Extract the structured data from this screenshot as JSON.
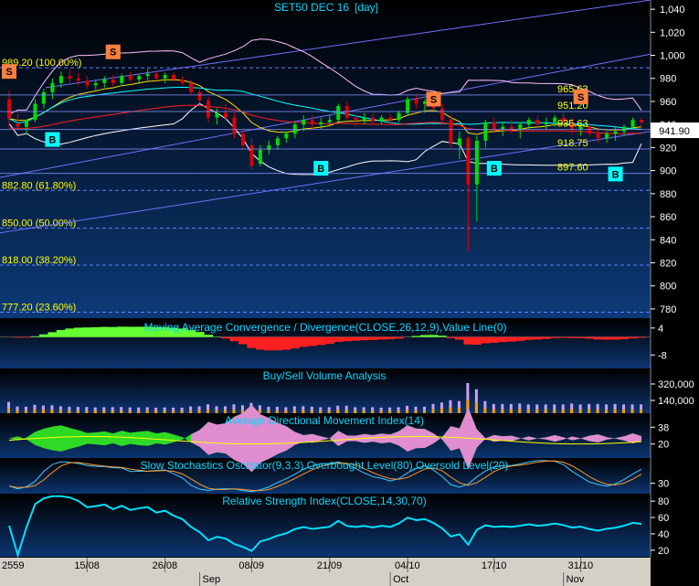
{
  "chart_data": {
    "type": "candlestick",
    "title": "SET50 DEC 16",
    "interval": "[day]",
    "colors": {
      "background_top": "#000000",
      "background_bottom": "#0b3a78",
      "up": "#00dd00",
      "down": "#dd0000",
      "signal_buy": "#00ffff",
      "signal_sell": "#ff8040",
      "axis_bg": "#000000",
      "date_bar": "#d4d0c8",
      "channel": "#7070ff",
      "fib": "#6080ff"
    },
    "price": {
      "ylim": [
        772,
        1048
      ],
      "yticks": [
        1040,
        1020,
        1000,
        980,
        960,
        940,
        920,
        900,
        880,
        860,
        840,
        820,
        800,
        780
      ],
      "ytick_labels": [
        "1,040",
        "1,020",
        "1,000",
        "980",
        "960",
        "940",
        "920",
        "900",
        "880",
        "860",
        "840",
        "820",
        "800",
        "780"
      ],
      "last": 941.9,
      "last_label": "941.90",
      "candles": [
        {
          "o": 962,
          "h": 970,
          "l": 938,
          "c": 945
        },
        {
          "o": 941,
          "h": 949,
          "l": 936,
          "c": 938
        },
        {
          "o": 938,
          "h": 944,
          "l": 932,
          "c": 944
        },
        {
          "o": 944,
          "h": 962,
          "l": 942,
          "c": 958
        },
        {
          "o": 958,
          "h": 971,
          "l": 954,
          "c": 968
        },
        {
          "o": 968,
          "h": 980,
          "l": 962,
          "c": 976
        },
        {
          "o": 976,
          "h": 986,
          "l": 972,
          "c": 982
        },
        {
          "o": 982,
          "h": 988,
          "l": 976,
          "c": 980
        },
        {
          "o": 980,
          "h": 985,
          "l": 974,
          "c": 978
        },
        {
          "o": 978,
          "h": 982,
          "l": 971,
          "c": 974
        },
        {
          "o": 974,
          "h": 979,
          "l": 970,
          "c": 976
        },
        {
          "o": 976,
          "h": 982,
          "l": 972,
          "c": 979
        },
        {
          "o": 979,
          "h": 983,
          "l": 973,
          "c": 976
        },
        {
          "o": 976,
          "h": 984,
          "l": 973,
          "c": 982
        },
        {
          "o": 982,
          "h": 986,
          "l": 977,
          "c": 979
        },
        {
          "o": 979,
          "h": 984,
          "l": 975,
          "c": 982
        },
        {
          "o": 982,
          "h": 988,
          "l": 978,
          "c": 984
        },
        {
          "o": 984,
          "h": 986,
          "l": 978,
          "c": 980
        },
        {
          "o": 980,
          "h": 985,
          "l": 976,
          "c": 983
        },
        {
          "o": 983,
          "h": 985,
          "l": 977,
          "c": 979
        },
        {
          "o": 979,
          "h": 982,
          "l": 974,
          "c": 976
        },
        {
          "o": 976,
          "h": 979,
          "l": 966,
          "c": 968
        },
        {
          "o": 968,
          "h": 972,
          "l": 958,
          "c": 961
        },
        {
          "o": 961,
          "h": 964,
          "l": 942,
          "c": 946
        },
        {
          "o": 946,
          "h": 954,
          "l": 940,
          "c": 950
        },
        {
          "o": 950,
          "h": 958,
          "l": 944,
          "c": 946
        },
        {
          "o": 946,
          "h": 950,
          "l": 928,
          "c": 932
        },
        {
          "o": 932,
          "h": 936,
          "l": 918,
          "c": 922
        },
        {
          "o": 922,
          "h": 928,
          "l": 900,
          "c": 904
        },
        {
          "o": 906,
          "h": 922,
          "l": 904,
          "c": 918
        },
        {
          "o": 918,
          "h": 926,
          "l": 914,
          "c": 922
        },
        {
          "o": 922,
          "h": 930,
          "l": 918,
          "c": 928
        },
        {
          "o": 928,
          "h": 934,
          "l": 924,
          "c": 932
        },
        {
          "o": 932,
          "h": 942,
          "l": 928,
          "c": 940
        },
        {
          "o": 940,
          "h": 948,
          "l": 934,
          "c": 944
        },
        {
          "o": 944,
          "h": 948,
          "l": 936,
          "c": 940
        },
        {
          "o": 940,
          "h": 946,
          "l": 936,
          "c": 942
        },
        {
          "o": 942,
          "h": 948,
          "l": 938,
          "c": 944
        },
        {
          "o": 944,
          "h": 958,
          "l": 942,
          "c": 956
        },
        {
          "o": 956,
          "h": 960,
          "l": 944,
          "c": 946
        },
        {
          "o": 946,
          "h": 948,
          "l": 938,
          "c": 944
        },
        {
          "o": 944,
          "h": 950,
          "l": 940,
          "c": 946
        },
        {
          "o": 946,
          "h": 950,
          "l": 940,
          "c": 943
        },
        {
          "o": 943,
          "h": 948,
          "l": 940,
          "c": 946
        },
        {
          "o": 946,
          "h": 949,
          "l": 940,
          "c": 944
        },
        {
          "o": 944,
          "h": 952,
          "l": 942,
          "c": 950
        },
        {
          "o": 950,
          "h": 964,
          "l": 948,
          "c": 962
        },
        {
          "o": 962,
          "h": 966,
          "l": 954,
          "c": 958
        },
        {
          "o": 958,
          "h": 962,
          "l": 950,
          "c": 960
        },
        {
          "o": 960,
          "h": 964,
          "l": 952,
          "c": 954
        },
        {
          "o": 954,
          "h": 958,
          "l": 940,
          "c": 944
        },
        {
          "o": 944,
          "h": 948,
          "l": 920,
          "c": 924
        },
        {
          "o": 922,
          "h": 934,
          "l": 910,
          "c": 928
        },
        {
          "o": 928,
          "h": 930,
          "l": 830,
          "c": 888
        },
        {
          "o": 888,
          "h": 930,
          "l": 856,
          "c": 926
        },
        {
          "o": 926,
          "h": 944,
          "l": 920,
          "c": 942
        },
        {
          "o": 942,
          "h": 946,
          "l": 934,
          "c": 936
        },
        {
          "o": 936,
          "h": 942,
          "l": 930,
          "c": 938
        },
        {
          "o": 938,
          "h": 944,
          "l": 932,
          "c": 936
        },
        {
          "o": 936,
          "h": 942,
          "l": 928,
          "c": 940
        },
        {
          "o": 940,
          "h": 946,
          "l": 936,
          "c": 944
        },
        {
          "o": 944,
          "h": 948,
          "l": 938,
          "c": 940
        },
        {
          "o": 940,
          "h": 946,
          "l": 936,
          "c": 942
        },
        {
          "o": 942,
          "h": 948,
          "l": 938,
          "c": 946
        },
        {
          "o": 946,
          "h": 950,
          "l": 940,
          "c": 942
        },
        {
          "o": 942,
          "h": 946,
          "l": 932,
          "c": 936
        },
        {
          "o": 936,
          "h": 940,
          "l": 930,
          "c": 938
        },
        {
          "o": 938,
          "h": 942,
          "l": 930,
          "c": 932
        },
        {
          "o": 932,
          "h": 936,
          "l": 924,
          "c": 928
        },
        {
          "o": 928,
          "h": 934,
          "l": 924,
          "c": 932
        },
        {
          "o": 932,
          "h": 938,
          "l": 926,
          "c": 934
        },
        {
          "o": 934,
          "h": 940,
          "l": 930,
          "c": 938
        },
        {
          "o": 938,
          "h": 946,
          "l": 936,
          "c": 944
        },
        {
          "o": 944,
          "h": 946,
          "l": 936,
          "c": 941.9
        }
      ],
      "fib_levels": [
        {
          "value": 989.2,
          "label": "989.20 (100.00%)"
        },
        {
          "value": 882.8,
          "label": "882.80 (61.80%)"
        },
        {
          "value": 850.0,
          "label": "850.00 (50.00%)"
        },
        {
          "value": 818.0,
          "label": "818.00 (38.20%)"
        },
        {
          "value": 777.2,
          "label": "777.20 (23.60%)"
        }
      ],
      "right_levels": [
        {
          "value": 965.63,
          "label": "965.63"
        },
        {
          "value": 951.2,
          "label": "951.20"
        },
        {
          "value": 935.63,
          "label": "935.63"
        },
        {
          "value": 918.75,
          "label": "918.75"
        },
        {
          "value": 897.6,
          "label": "897.60"
        }
      ],
      "signals": [
        {
          "i": 0,
          "side": "S",
          "price": 986
        },
        {
          "i": 5,
          "side": "B",
          "price": 927
        },
        {
          "i": 12,
          "side": "S",
          "price": 1003
        },
        {
          "i": 36,
          "side": "B",
          "price": 902
        },
        {
          "i": 49,
          "side": "S",
          "price": 962
        },
        {
          "i": 56,
          "side": "B",
          "price": 902
        },
        {
          "i": 66,
          "side": "S",
          "price": 964
        },
        {
          "i": 70,
          "side": "B",
          "price": 897
        }
      ]
    },
    "macd": {
      "title": "Moving Average Convergence / Divergence(CLOSE,26,12,9),Value Line(0)",
      "yticks": [
        4,
        -8
      ],
      "ylim": [
        -14,
        8
      ]
    },
    "volume": {
      "title": "Buy/Sell Volume Analysis",
      "yticks": [
        320000,
        140000
      ],
      "ytick_labels": [
        "320,000",
        "140,000"
      ],
      "ylim": [
        0,
        480000
      ]
    },
    "adx": {
      "title": "Average Directional Movement Index(14)",
      "yticks": [
        38,
        20
      ],
      "ylim": [
        5,
        52
      ]
    },
    "stoch": {
      "title": "Slow Stochastics Oscillator(9,3,3),Overbought Level(80),Oversold Level(20)",
      "yticks": [
        30
      ],
      "ylim": [
        0,
        100
      ]
    },
    "rsi": {
      "title": "Relative Strength Index(CLOSE,14,30,70)",
      "yticks": [
        80,
        60,
        40,
        20
      ],
      "ylim": [
        12,
        88
      ]
    },
    "x_axis": {
      "year_label": "2559",
      "date_ticks": [
        {
          "i": 9,
          "label": "15/08"
        },
        {
          "i": 18,
          "label": "26/08"
        },
        {
          "i": 28,
          "label": "08/09"
        },
        {
          "i": 37,
          "label": "21/09"
        },
        {
          "i": 46,
          "label": "04/10"
        },
        {
          "i": 56,
          "label": "17/10"
        },
        {
          "i": 66,
          "label": "31/10"
        }
      ],
      "month_ticks": [
        {
          "i": 22,
          "label": "Sep"
        },
        {
          "i": 44,
          "label": "Oct"
        },
        {
          "i": 64,
          "label": "Nov"
        }
      ]
    }
  }
}
